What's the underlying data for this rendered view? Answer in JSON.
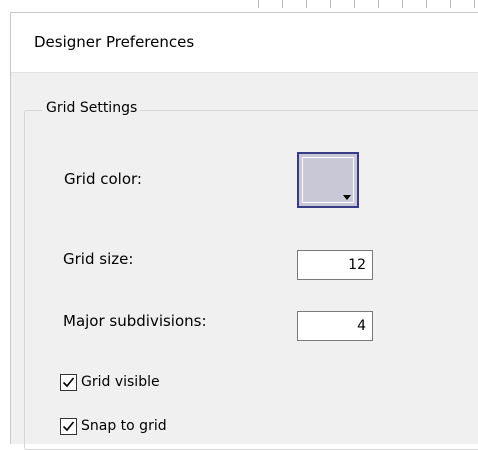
{
  "dialog": {
    "title": "Designer Preferences"
  },
  "grid_settings": {
    "legend": "Grid Settings",
    "grid_color_label": "Grid color:",
    "grid_color_value": "#c9c8d6",
    "grid_size_label": "Grid size:",
    "grid_size_value": "12",
    "major_subdivisions_label": "Major subdivisions:",
    "major_subdivisions_value": "4",
    "grid_visible_label": "Grid visible",
    "grid_visible_checked": true,
    "snap_to_grid_label": "Snap to grid",
    "snap_to_grid_checked": true
  },
  "icons": {
    "color_dropdown": "chevron-down-icon",
    "checkmark": "checkmark-icon"
  }
}
